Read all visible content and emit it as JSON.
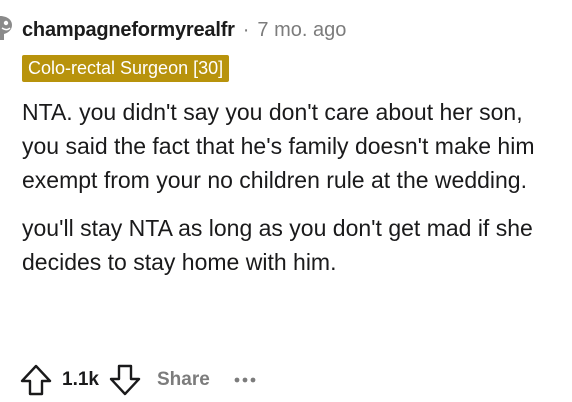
{
  "comment": {
    "username": "champagneformyrealfr",
    "separator": "·",
    "timestamp": "7 mo. ago",
    "flair": {
      "text": "Colo-rectal Surgeon [30]",
      "color": "#b8930c"
    },
    "paragraphs": [
      "NTA. you didn't say you don't care about her son, you said the fact that he's family doesn't make him exempt from your no children rule at the wedding.",
      "you'll stay NTA as long as you don't get mad if she decides to stay home with him."
    ],
    "actions": {
      "upvote_icon": "upvote-arrow-icon",
      "score": "1.1k",
      "downvote_icon": "downvote-arrow-icon",
      "share_label": "Share",
      "more_icon": "more-options-icon"
    }
  }
}
